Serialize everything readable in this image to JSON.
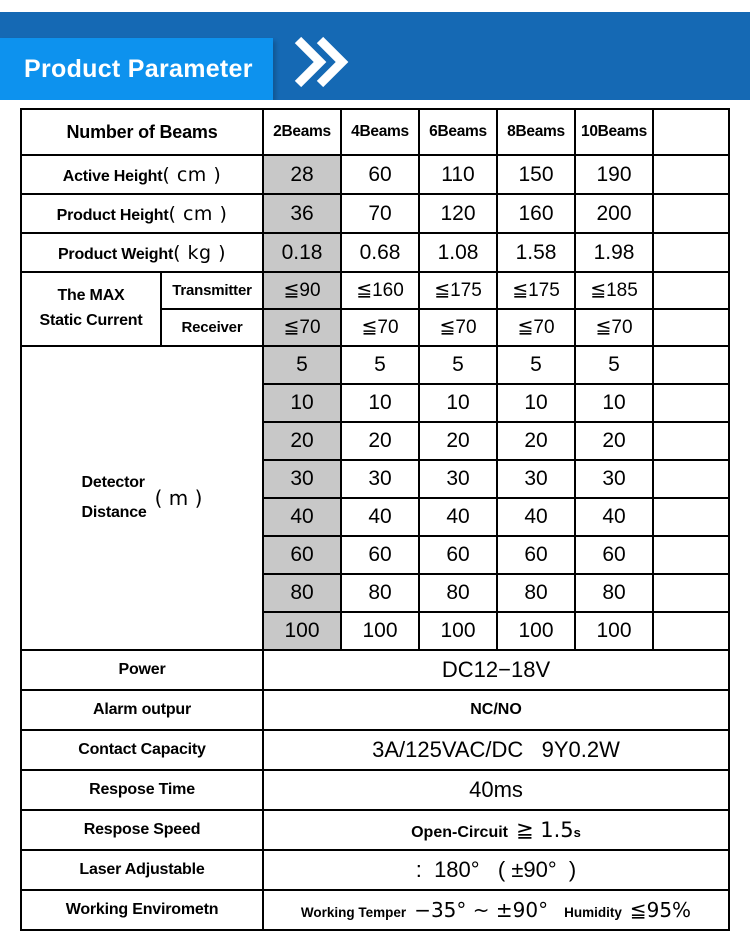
{
  "banner": {
    "title": "Product Parameter",
    "chevron_icon": "double-chevron-right-icon",
    "color_dark": "#1569b4",
    "color_light": "#0d92ee"
  },
  "table": {
    "highlight_color": "#c8c8c8",
    "header": {
      "label": "Number of Beams",
      "columns": [
        "2Beams",
        "4Beams",
        "6Beams",
        "8Beams",
        "10Beams",
        ""
      ]
    },
    "rows": [
      {
        "label": "Active Height",
        "unit": "( cm )",
        "values": [
          "28",
          "60",
          "110",
          "150",
          "190"
        ]
      },
      {
        "label": "Product Height",
        "unit": "( cm )",
        "values": [
          "36",
          "70",
          "120",
          "160",
          "200"
        ]
      },
      {
        "label": "Product Weight",
        "unit": "( kg )",
        "values": [
          "0.18",
          "0.68",
          "1.08",
          "1.58",
          "1.98"
        ]
      }
    ],
    "max_static_current": {
      "label_line1": "The MAX",
      "label_line2": "Static Current",
      "sub_rows": [
        {
          "sub_label": "Transmitter",
          "values": [
            "≦90",
            "≦160",
            "≦175",
            "≦175",
            "≦185"
          ]
        },
        {
          "sub_label": "Receiver",
          "values": [
            "≦70",
            "≦70",
            "≦70",
            "≦70",
            "≦70"
          ]
        }
      ]
    },
    "detector_distance": {
      "label_line1": "Detector",
      "label_line2": "Distance",
      "unit": "( m )",
      "rows": [
        [
          "5",
          "5",
          "5",
          "5",
          "5"
        ],
        [
          "10",
          "10",
          "10",
          "10",
          "10"
        ],
        [
          "20",
          "20",
          "20",
          "20",
          "20"
        ],
        [
          "30",
          "30",
          "30",
          "30",
          "30"
        ],
        [
          "40",
          "40",
          "40",
          "40",
          "40"
        ],
        [
          "60",
          "60",
          "60",
          "60",
          "60"
        ],
        [
          "80",
          "80",
          "80",
          "80",
          "80"
        ],
        [
          "100",
          "100",
          "100",
          "100",
          "100"
        ]
      ]
    },
    "footer_rows": [
      {
        "label": "Power",
        "value": "DC12−18V",
        "style": "light"
      },
      {
        "label": "Alarm outpur",
        "value": "NC/NO",
        "style": "bold"
      },
      {
        "label": "Contact Capacity",
        "value": "3A/125VAC/DC   9Y0.2W",
        "style": "light"
      },
      {
        "label": "Respose Time",
        "value": "40ms",
        "style": "light"
      }
    ],
    "respose_speed": {
      "label": "Respose Speed",
      "value_bold": "Open-Circuit",
      "value_sym": "≧ 1.5",
      "value_unit": "s"
    },
    "laser_adjustable": {
      "label": "Laser Adjustable",
      "value": ":  180°   ( ±90°  )"
    },
    "working_environment": {
      "label": "Working Envirometn",
      "temp_label": "Working Temper",
      "temp_value": "−35°  ~ ±90°",
      "humidity_label": "Humidity",
      "humidity_value": "≦95%"
    }
  }
}
